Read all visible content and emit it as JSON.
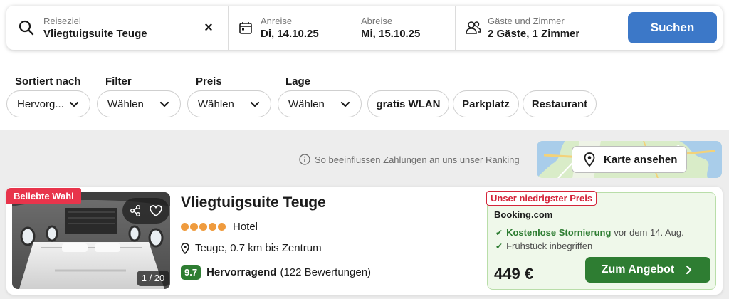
{
  "search": {
    "destination_label": "Reiseziel",
    "destination_value": "Vliegtuigsuite Teuge",
    "checkin_label": "Anreise",
    "checkin_value": "Di, 14.10.25",
    "checkout_label": "Abreise",
    "checkout_value": "Mi, 15.10.25",
    "guests_label": "Gäste und Zimmer",
    "guests_value": "2 Gäste, 1 Zimmer",
    "search_button": "Suchen"
  },
  "filters": {
    "sort": {
      "label": "Sortiert nach",
      "value": "Hervorg..."
    },
    "filter": {
      "label": "Filter",
      "value": "Wählen"
    },
    "price": {
      "label": "Preis",
      "value": "Wählen"
    },
    "location": {
      "label": "Lage",
      "value": "Wählen"
    },
    "quick": [
      "gratis WLAN",
      "Parkplatz",
      "Restaurant"
    ]
  },
  "ranking_note": "So beeinflussen Zahlungen an uns unser Ranking",
  "map_button": "Karte ansehen",
  "result": {
    "badge": "Beliebte Wahl",
    "image_counter": "1 / 20",
    "name": "Vliegtuigsuite Teuge",
    "stars": 5,
    "type": "Hotel",
    "location": "Teuge, 0.7 km bis Zentrum",
    "score": "9.7",
    "rating_word": "Hervorragend",
    "reviews": "(122 Bewertungen)",
    "deal_tag": "Unser niedrigster Preis",
    "provider": "Booking.com",
    "perk1_bold": "Kostenlose Stornierung",
    "perk1_rest": "vor dem 14. Aug.",
    "perk2": "Frühstück inbegriffen",
    "price": "449 €",
    "deal_button": "Zum Angebot"
  },
  "colors": {
    "primary_blue": "#3c78c8",
    "deal_green": "#2e7d32",
    "badge_red": "#e8344b",
    "star_orange": "#ef9b3e"
  },
  "icons": [
    "search-icon",
    "close-icon",
    "calendar-icon",
    "guests-icon",
    "chevron-down-icon",
    "info-icon",
    "map-pin-icon",
    "share-icon",
    "heart-icon",
    "check-icon",
    "chevron-right-icon"
  ]
}
